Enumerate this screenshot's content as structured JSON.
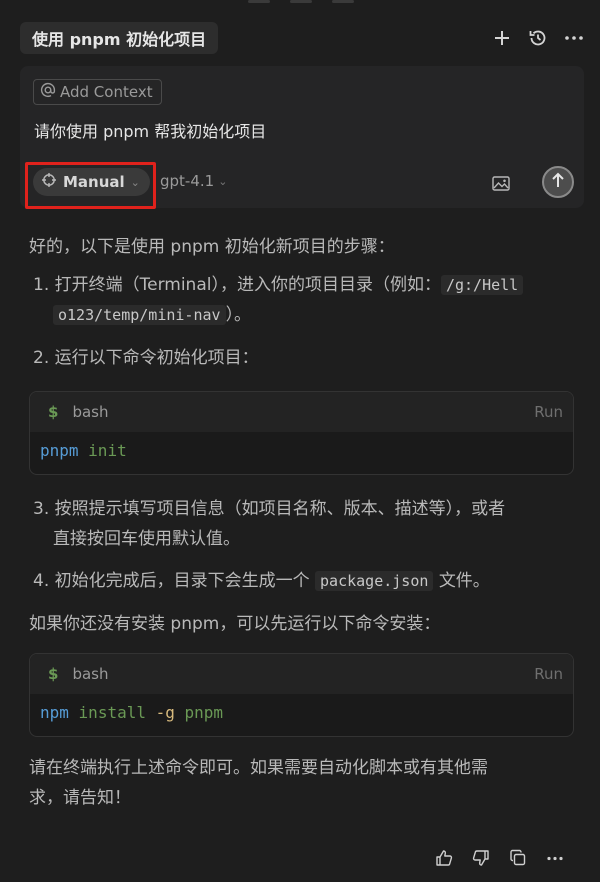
{
  "header": {
    "title": "使用 pnpm 初始化项目",
    "icons": [
      "plus-icon",
      "history-icon",
      "more-icon"
    ]
  },
  "composer": {
    "add_context_label": "Add Context",
    "prompt_text": "请你使用 pnpm 帮我初始化项目",
    "mode_label": "Manual",
    "model_label": "gpt-4.1",
    "icons": [
      "at-icon",
      "crosshair-icon",
      "image-icon",
      "send-arrow-up-icon"
    ]
  },
  "answer": {
    "intro": "好的，以下是使用 pnpm 初始化新项目的步骤：",
    "step1_prefix": "1. 打开终端（Terminal），进入你的项目目录（例如：",
    "step1_code_a": "/g:/Hell",
    "step1_code_b": "o123/temp/mini-nav",
    "step1_suffix": "）。",
    "step2": "2. 运行以下命令初始化项目：",
    "code1": {
      "lang": "bash",
      "run_label": "Run",
      "cmd": "pnpm",
      "args": "init"
    },
    "step3_line1": "3. 按照提示填写项目信息（如项目名称、版本、描述等），或者",
    "step3_line2": "直接按回车使用默认值。",
    "step4_prefix": "4. 初始化完成后，目录下会生成一个",
    "step4_code": "package.json",
    "step4_suffix": "文件。",
    "install_intro": "如果你还没有安装 pnpm，可以先运行以下命令安装：",
    "code2": {
      "lang": "bash",
      "run_label": "Run",
      "cmd": "npm",
      "args": "install",
      "flag": "-g",
      "pkg": "pnpm"
    },
    "closing_line1": "请在终端执行上述命令即可。如果需要自动化脚本或有其他需",
    "closing_line2": "求，请告知！"
  },
  "footer": {
    "icons": [
      "thumbs-up-icon",
      "thumbs-down-icon",
      "copy-icon",
      "more-icon"
    ]
  },
  "colors": {
    "highlight": "#e0221c",
    "bg": "#1e1e1e",
    "panel": "#252526"
  }
}
